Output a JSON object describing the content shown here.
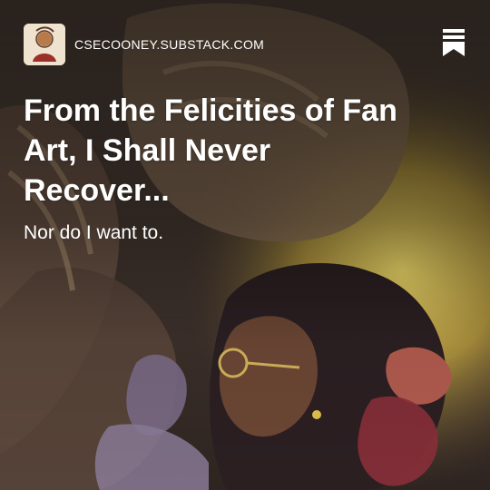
{
  "header": {
    "site_name": "CSECOONEY.SUBSTACK.COM",
    "avatar_icon": "portrait-avatar-icon",
    "bookmark_icon": "bookmark-icon"
  },
  "post": {
    "title": "From the Felicities of Fan Art, I Shall Never Recover...",
    "subtitle": "Nor do I want to."
  },
  "colors": {
    "text": "#ffffff",
    "glow": "#e8c85a"
  }
}
